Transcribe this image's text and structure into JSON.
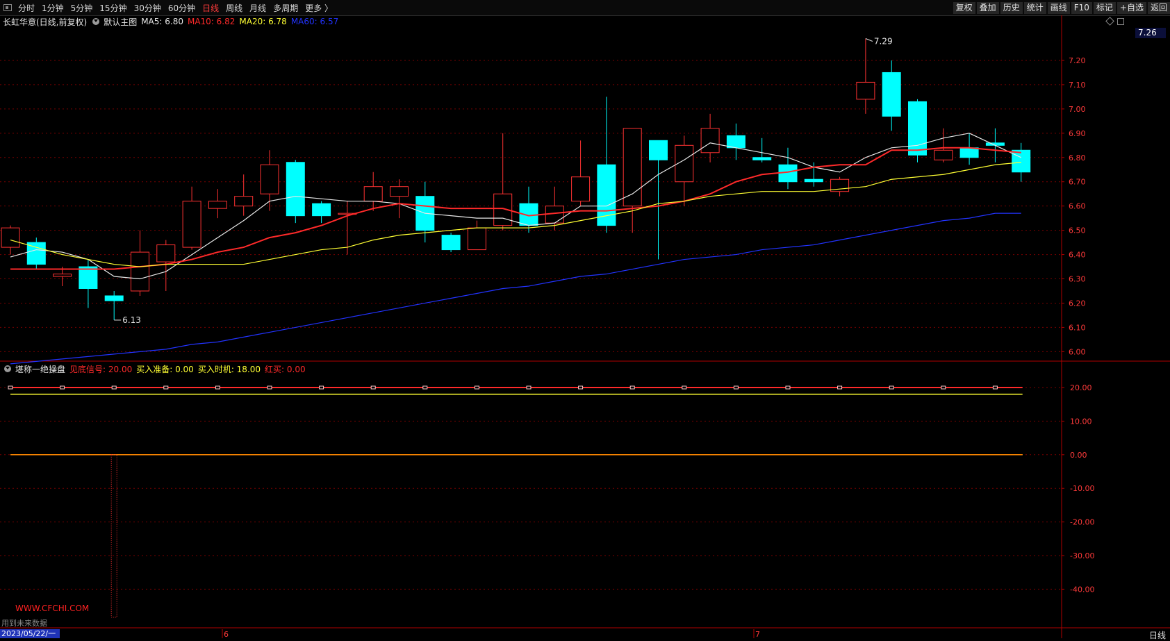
{
  "toolbar": {
    "left_items": [
      {
        "label": "分时",
        "active": false
      },
      {
        "label": "1分钟",
        "active": false
      },
      {
        "label": "5分钟",
        "active": false
      },
      {
        "label": "15分钟",
        "active": false
      },
      {
        "label": "30分钟",
        "active": false
      },
      {
        "label": "60分钟",
        "active": false
      },
      {
        "label": "日线",
        "active": true
      },
      {
        "label": "周线",
        "active": false
      },
      {
        "label": "月线",
        "active": false
      },
      {
        "label": "多周期",
        "active": false
      },
      {
        "label": "更多 〉",
        "active": false
      }
    ],
    "right_items": [
      "复权",
      "叠加",
      "历史",
      "统计",
      "画线",
      "F10",
      "标记",
      "+自选",
      "返回"
    ]
  },
  "main_panel": {
    "stock_name": "长虹华意(日线,前复权)",
    "template_name": "默认主图",
    "indicators": [
      {
        "label": "MA5: 6.80",
        "color": "#e8e8e8"
      },
      {
        "label": "MA10: 6.82",
        "color": "#ff2a2a"
      },
      {
        "label": "MA20: 6.78",
        "color": "#ffff33"
      },
      {
        "label": "MA60: 6.57",
        "color": "#2233ff"
      }
    ],
    "current_price": "7.26",
    "high_label": "7.29",
    "low_label": "6.13"
  },
  "sub_panel": {
    "title": "堪称一绝操盘",
    "indicators": [
      {
        "label": "见底信号: 20.00",
        "color": "#ff2a2a"
      },
      {
        "label": "买入准备: 0.00",
        "color": "#ffff33"
      },
      {
        "label": "买入时机: 18.00",
        "color": "#ffff33"
      },
      {
        "label": "红买: 0.00",
        "color": "#ff2a2a"
      }
    ]
  },
  "footer": {
    "watermark": "WWW.CFCHI.COM",
    "future_note": "用到未来数据",
    "date": "2023/05/22/一",
    "period": "日线",
    "month_markers": [
      "6",
      "7"
    ]
  },
  "colors": {
    "up": "#ff3232",
    "down": "#00ffff",
    "ma5": "#e8e8e8",
    "ma10": "#ff2a2a",
    "ma20": "#ffff33",
    "ma60": "#2233ff",
    "grid": "#7a0000",
    "axis": "#b00000"
  },
  "chart_data": [
    {
      "type": "candlestick",
      "title": "长虹华意(日线,前复权)",
      "ylim": [
        5.96,
        7.29
      ],
      "y_ticks": [
        "7.20",
        "7.10",
        "7.00",
        "6.90",
        "6.80",
        "6.70",
        "6.60",
        "6.50",
        "6.40",
        "6.30",
        "6.20",
        "6.10",
        "6.00"
      ],
      "candles": [
        {
          "o": 6.43,
          "h": 6.52,
          "l": 6.4,
          "c": 6.51
        },
        {
          "o": 6.45,
          "h": 6.47,
          "l": 6.34,
          "c": 6.36
        },
        {
          "o": 6.31,
          "h": 6.35,
          "l": 6.27,
          "c": 6.32
        },
        {
          "o": 6.35,
          "h": 6.38,
          "l": 6.18,
          "c": 6.26
        },
        {
          "o": 6.23,
          "h": 6.25,
          "l": 6.13,
          "c": 6.21
        },
        {
          "o": 6.25,
          "h": 6.5,
          "l": 6.23,
          "c": 6.41
        },
        {
          "o": 6.37,
          "h": 6.46,
          "l": 6.25,
          "c": 6.44
        },
        {
          "o": 6.43,
          "h": 6.68,
          "l": 6.42,
          "c": 6.62
        },
        {
          "o": 6.59,
          "h": 6.67,
          "l": 6.55,
          "c": 6.62
        },
        {
          "o": 6.6,
          "h": 6.73,
          "l": 6.56,
          "c": 6.64
        },
        {
          "o": 6.65,
          "h": 6.83,
          "l": 6.58,
          "c": 6.77
        },
        {
          "o": 6.78,
          "h": 6.79,
          "l": 6.53,
          "c": 6.56
        },
        {
          "o": 6.61,
          "h": 6.62,
          "l": 6.53,
          "c": 6.56
        },
        {
          "o": 6.57,
          "h": 6.62,
          "l": 6.4,
          "c": 6.57
        },
        {
          "o": 6.62,
          "h": 6.74,
          "l": 6.58,
          "c": 6.68
        },
        {
          "o": 6.64,
          "h": 6.71,
          "l": 6.55,
          "c": 6.68
        },
        {
          "o": 6.64,
          "h": 6.7,
          "l": 6.45,
          "c": 6.5
        },
        {
          "o": 6.48,
          "h": 6.49,
          "l": 6.41,
          "c": 6.42
        },
        {
          "o": 6.42,
          "h": 6.54,
          "l": 6.42,
          "c": 6.51
        },
        {
          "o": 6.52,
          "h": 6.9,
          "l": 6.5,
          "c": 6.65
        },
        {
          "o": 6.61,
          "h": 6.68,
          "l": 6.49,
          "c": 6.52
        },
        {
          "o": 6.53,
          "h": 6.68,
          "l": 6.5,
          "c": 6.6
        },
        {
          "o": 6.62,
          "h": 6.87,
          "l": 6.6,
          "c": 6.72
        },
        {
          "o": 6.77,
          "h": 7.05,
          "l": 6.49,
          "c": 6.52
        },
        {
          "o": 6.6,
          "h": 6.92,
          "l": 6.49,
          "c": 6.92
        },
        {
          "o": 6.87,
          "h": 6.87,
          "l": 6.38,
          "c": 6.79
        },
        {
          "o": 6.7,
          "h": 6.89,
          "l": 6.6,
          "c": 6.85
        },
        {
          "o": 6.82,
          "h": 6.98,
          "l": 6.78,
          "c": 6.92
        },
        {
          "o": 6.89,
          "h": 6.94,
          "l": 6.79,
          "c": 6.84
        },
        {
          "o": 6.8,
          "h": 6.88,
          "l": 6.78,
          "c": 6.79
        },
        {
          "o": 6.77,
          "h": 6.84,
          "l": 6.67,
          "c": 6.7
        },
        {
          "o": 6.71,
          "h": 6.78,
          "l": 6.68,
          "c": 6.7
        },
        {
          "o": 6.66,
          "h": 6.72,
          "l": 6.64,
          "c": 6.71
        },
        {
          "o": 7.04,
          "h": 7.29,
          "l": 6.98,
          "c": 7.11
        },
        {
          "o": 7.15,
          "h": 7.2,
          "l": 6.91,
          "c": 6.97
        },
        {
          "o": 7.03,
          "h": 7.04,
          "l": 6.78,
          "c": 6.81
        },
        {
          "o": 6.79,
          "h": 6.92,
          "l": 6.78,
          "c": 6.83
        },
        {
          "o": 6.84,
          "h": 6.9,
          "l": 6.77,
          "c": 6.8
        },
        {
          "o": 6.86,
          "h": 6.92,
          "l": 6.78,
          "c": 6.85
        },
        {
          "o": 6.83,
          "h": 6.86,
          "l": 6.7,
          "c": 6.74
        }
      ],
      "series": [
        {
          "name": "MA5",
          "values": [
            6.39,
            6.42,
            6.41,
            6.38,
            6.31,
            6.3,
            6.33,
            6.4,
            6.47,
            6.54,
            6.62,
            6.64,
            6.63,
            6.62,
            6.62,
            6.61,
            6.57,
            6.56,
            6.55,
            6.55,
            6.52,
            6.53,
            6.6,
            6.6,
            6.65,
            6.73,
            6.79,
            6.86,
            6.84,
            6.82,
            6.8,
            6.76,
            6.74,
            6.8,
            6.84,
            6.85,
            6.88,
            6.9,
            6.85,
            6.8
          ]
        },
        {
          "name": "MA10",
          "values": [
            6.34,
            6.34,
            6.34,
            6.34,
            6.34,
            6.35,
            6.36,
            6.38,
            6.41,
            6.43,
            6.47,
            6.49,
            6.52,
            6.56,
            6.59,
            6.61,
            6.6,
            6.59,
            6.59,
            6.59,
            6.56,
            6.57,
            6.58,
            6.58,
            6.59,
            6.6,
            6.62,
            6.65,
            6.7,
            6.73,
            6.74,
            6.76,
            6.77,
            6.77,
            6.83,
            6.83,
            6.84,
            6.84,
            6.83,
            6.82
          ]
        },
        {
          "name": "MA20",
          "values": [
            6.46,
            6.43,
            6.4,
            6.38,
            6.36,
            6.35,
            6.36,
            6.36,
            6.36,
            6.36,
            6.38,
            6.4,
            6.42,
            6.43,
            6.46,
            6.48,
            6.49,
            6.5,
            6.51,
            6.51,
            6.51,
            6.52,
            6.54,
            6.56,
            6.58,
            6.61,
            6.62,
            6.64,
            6.65,
            6.66,
            6.66,
            6.66,
            6.67,
            6.68,
            6.71,
            6.72,
            6.73,
            6.75,
            6.77,
            6.78
          ]
        },
        {
          "name": "MA60",
          "values": [
            5.95,
            5.96,
            5.97,
            5.98,
            5.99,
            6.0,
            6.01,
            6.03,
            6.04,
            6.06,
            6.08,
            6.1,
            6.12,
            6.14,
            6.16,
            6.18,
            6.2,
            6.22,
            6.24,
            6.26,
            6.27,
            6.29,
            6.31,
            6.32,
            6.34,
            6.36,
            6.38,
            6.39,
            6.4,
            6.42,
            6.43,
            6.44,
            6.46,
            6.48,
            6.5,
            6.52,
            6.54,
            6.55,
            6.57,
            6.57
          ]
        }
      ]
    },
    {
      "type": "line",
      "title": "堪称一绝操盘",
      "ylim": [
        -50,
        25
      ],
      "y_ticks": [
        "20.00",
        "10.00",
        "0.00",
        "-10.00",
        "-20.00",
        "-30.00",
        "-40.00"
      ],
      "series": [
        {
          "name": "见底信号",
          "values": [
            20.0
          ]
        },
        {
          "name": "买入准备",
          "values": [
            0.0
          ]
        },
        {
          "name": "买入时机",
          "values": [
            18.0
          ]
        },
        {
          "name": "红买",
          "values": [
            0.0
          ]
        }
      ],
      "bar_at_index": 4,
      "bar_value": -50
    }
  ]
}
